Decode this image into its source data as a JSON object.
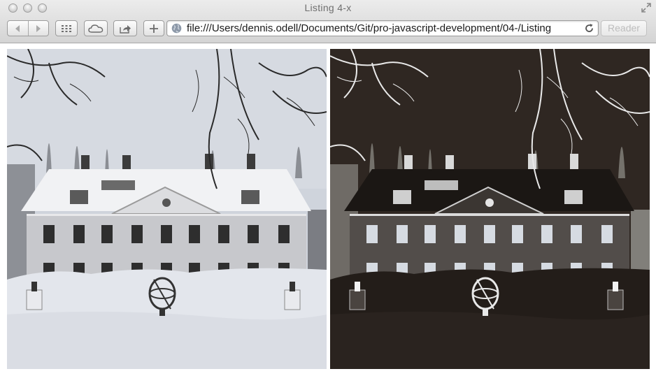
{
  "window": {
    "title": "Listing 4-x"
  },
  "toolbar": {
    "back_icon": "back-arrow-icon",
    "forward_icon": "forward-arrow-icon",
    "top_sites_icon": "grid-icon",
    "icloud_icon": "cloud-icon",
    "share_icon": "share-icon",
    "add_bookmark_icon": "plus-icon",
    "reader_label": "Reader"
  },
  "address_bar": {
    "url": "file:///Users/dennis.odell/Documents/Git/pro-javascript-development/04-/Listing",
    "site_icon": "globe-icon",
    "reload_icon": "reload-icon"
  },
  "content": {
    "images": [
      {
        "name": "original-image",
        "description_tone": "grayscale"
      },
      {
        "name": "inverted-image",
        "description_tone": "negative"
      }
    ]
  },
  "colors": {
    "chrome_top": "#ececec",
    "chrome_bottom": "#d4d4d4",
    "inverted_bg": "#2f2722",
    "snow": "#e3e6ec"
  }
}
